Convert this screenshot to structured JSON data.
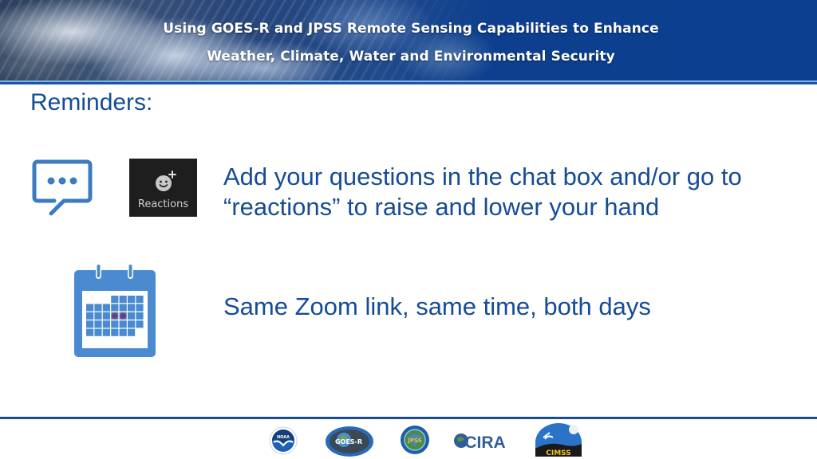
{
  "header": {
    "title_line1": "Using GOES-R and JPSS Remote Sensing Capabilities to Enhance",
    "title_line2": "Weather, Climate, Water and Environmental Security"
  },
  "slide": {
    "title": "Reminders:",
    "items": [
      {
        "icons": [
          "chat-bubble-icon",
          "reactions-icon"
        ],
        "reactions_label": "Reactions",
        "text": "Add your questions in the chat box and/or go to “reactions” to raise and lower your hand"
      },
      {
        "icons": [
          "calendar-icon"
        ],
        "text": "Same Zoom link, same time, both days"
      }
    ]
  },
  "footer": {
    "logos": [
      {
        "name": "NOAA",
        "text": "NOAA"
      },
      {
        "name": "GOES-R",
        "text": "GOES-R"
      },
      {
        "name": "JPSS",
        "text": "JPSS"
      },
      {
        "name": "CIRA",
        "text": "CIRA"
      },
      {
        "name": "CIMSS",
        "text": "CIMSS"
      }
    ]
  },
  "colors": {
    "brand_blue": "#154c97",
    "icon_blue": "#3b7cc0",
    "header_blue": "#0b3f8f",
    "reactions_bg": "#1e1e1e"
  }
}
